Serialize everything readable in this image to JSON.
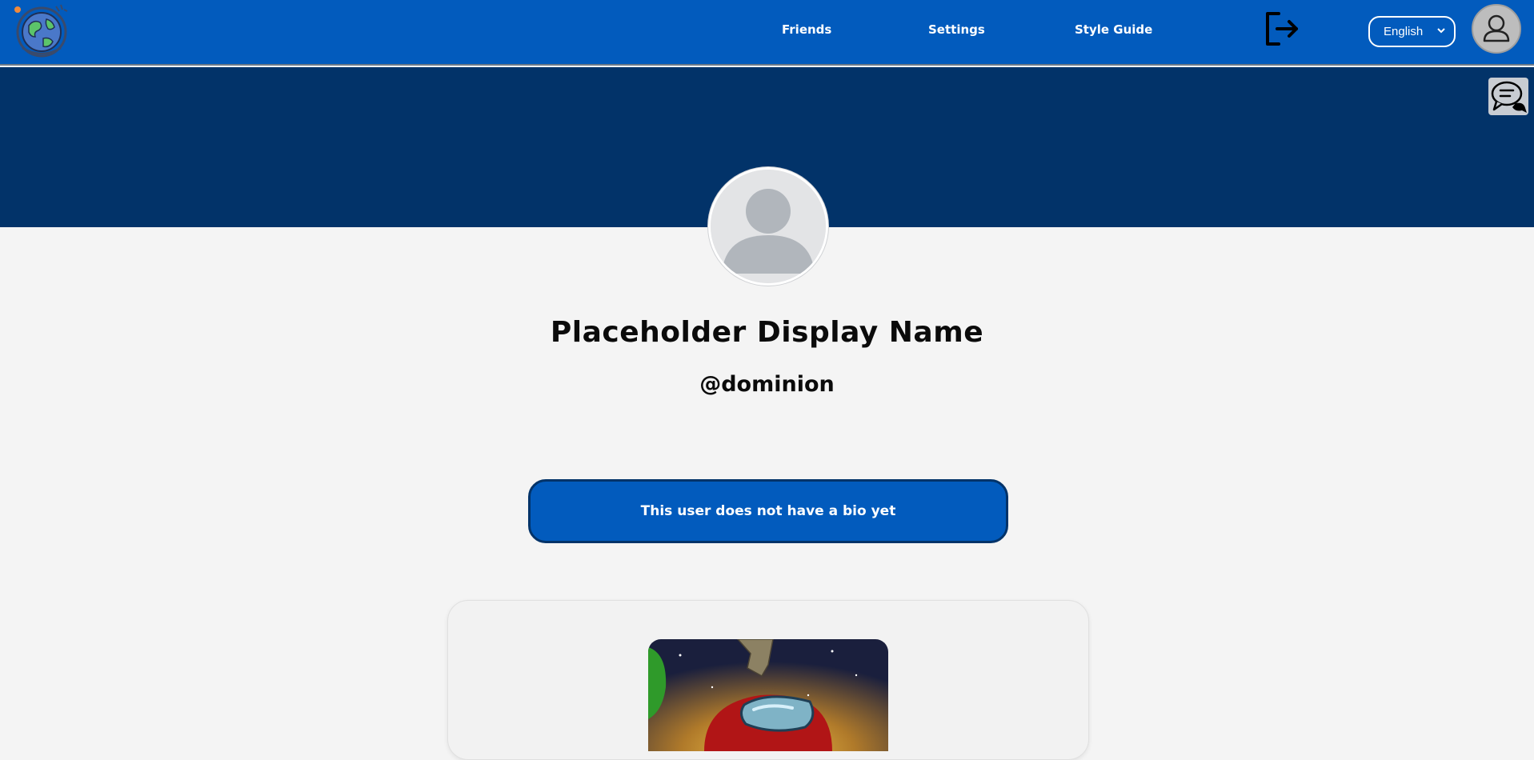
{
  "nav": {
    "friends_label": "Friends",
    "settings_label": "Settings",
    "style_guide_label": "Style Guide",
    "language_selected": "English"
  },
  "profile": {
    "display_name": "Placeholder Display Name",
    "username": "@dominion",
    "bio": "This user does not have a bio yet"
  },
  "icons": {
    "logo": "globe-logo-icon",
    "logout": "logout-icon",
    "user": "user-avatar-icon",
    "chat": "chat-bubbles-icon"
  },
  "colors": {
    "nav_blue": "#025bbd",
    "banner_navy": "#023369",
    "page_bg": "#f4f4f4"
  }
}
